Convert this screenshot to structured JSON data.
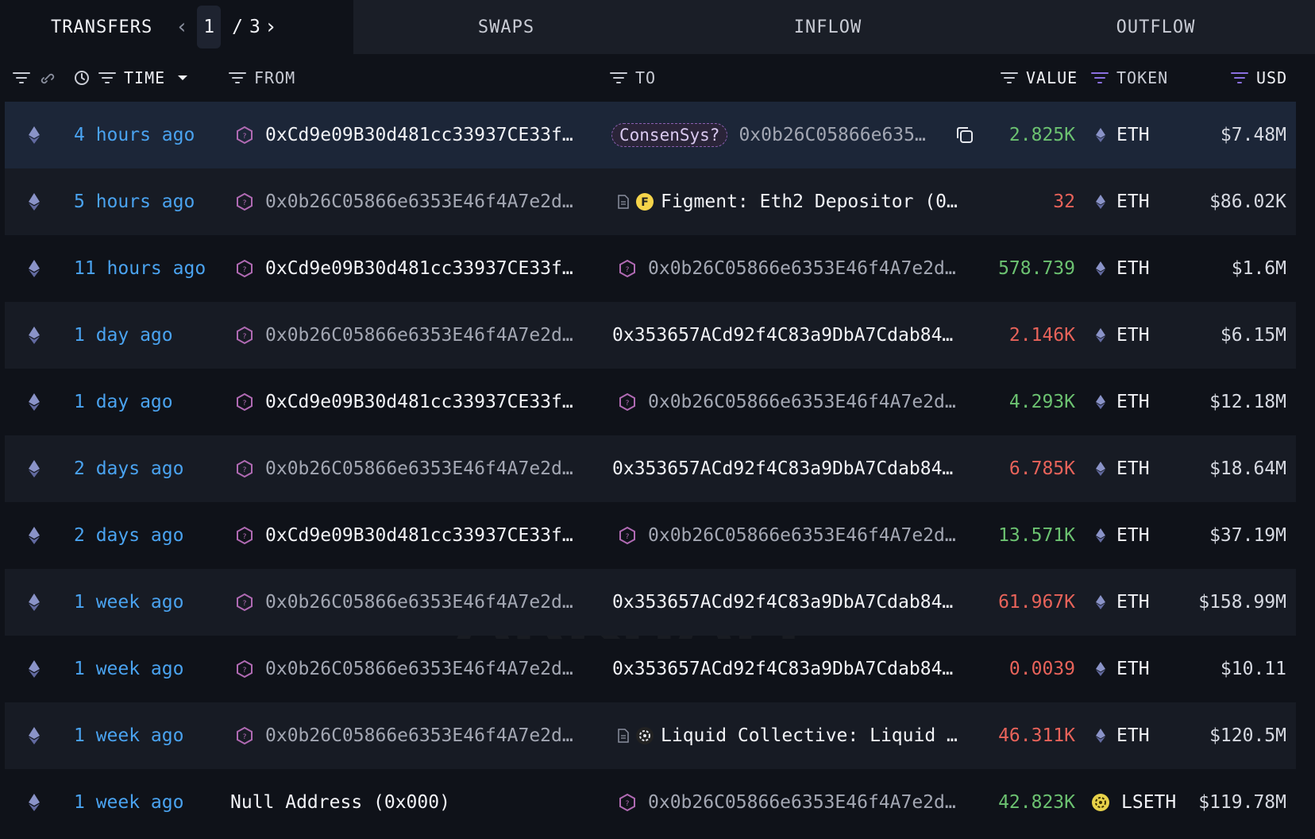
{
  "tabs": {
    "transfers": "TRANSFERS",
    "swaps": "SWAPS",
    "inflow": "INFLOW",
    "outflow": "OUTFLOW"
  },
  "pager": {
    "current": "1",
    "separator": "/",
    "total": "3"
  },
  "columns": {
    "time": "TIME",
    "from": "FROM",
    "to": "TO",
    "value": "VALUE",
    "token": "TOKEN",
    "usd": "USD"
  },
  "watermark": "ARKHAM",
  "colors": {
    "time_link": "#4aa3f0",
    "value_in": "#6cc271",
    "value_out": "#e8635a",
    "selected_row": "#1c2638"
  },
  "rows": [
    {
      "time": "4 hours ago",
      "from": "0xCd9e09B30d481cc33937CE33f…",
      "to_tag": "ConsenSys?",
      "to": "0x0b26C05866e635…",
      "value": "2.825K",
      "token": "ETH",
      "usd": "$7.48M"
    },
    {
      "time": "5 hours ago",
      "from": "0x0b26C05866e6353E46f4A7e2d…",
      "to": "Figment: Eth2 Depositor (0…",
      "value": "32",
      "token": "ETH",
      "usd": "$86.02K"
    },
    {
      "time": "11 hours ago",
      "from": "0xCd9e09B30d481cc33937CE33f…",
      "to": "0x0b26C05866e6353E46f4A7e2d…",
      "value": "578.739",
      "token": "ETH",
      "usd": "$1.6M"
    },
    {
      "time": "1 day ago",
      "from": "0x0b26C05866e6353E46f4A7e2d…",
      "to": "0x353657ACd92f4C83a9DbA7Cdab84…",
      "value": "2.146K",
      "token": "ETH",
      "usd": "$6.15M"
    },
    {
      "time": "1 day ago",
      "from": "0xCd9e09B30d481cc33937CE33f…",
      "to": "0x0b26C05866e6353E46f4A7e2d…",
      "value": "4.293K",
      "token": "ETH",
      "usd": "$12.18M"
    },
    {
      "time": "2 days ago",
      "from": "0x0b26C05866e6353E46f4A7e2d…",
      "to": "0x353657ACd92f4C83a9DbA7Cdab84…",
      "value": "6.785K",
      "token": "ETH",
      "usd": "$18.64M"
    },
    {
      "time": "2 days ago",
      "from": "0xCd9e09B30d481cc33937CE33f…",
      "to": "0x0b26C05866e6353E46f4A7e2d…",
      "value": "13.571K",
      "token": "ETH",
      "usd": "$37.19M"
    },
    {
      "time": "1 week ago",
      "from": "0x0b26C05866e6353E46f4A7e2d…",
      "to": "0x353657ACd92f4C83a9DbA7Cdab84…",
      "value": "61.967K",
      "token": "ETH",
      "usd": "$158.99M"
    },
    {
      "time": "1 week ago",
      "from": "0x0b26C05866e6353E46f4A7e2d…",
      "to": "0x353657ACd92f4C83a9DbA7Cdab84…",
      "value": "0.0039",
      "token": "ETH",
      "usd": "$10.11"
    },
    {
      "time": "1 week ago",
      "from": "0x0b26C05866e6353E46f4A7e2d…",
      "to": "Liquid Collective: Liquid …",
      "value": "46.311K",
      "token": "ETH",
      "usd": "$120.5M"
    },
    {
      "time": "1 week ago",
      "from": "Null Address (0x000)",
      "to": "0x0b26C05866e6353E46f4A7e2d…",
      "value": "42.823K",
      "token": "LSETH",
      "usd": "$119.78M"
    }
  ]
}
